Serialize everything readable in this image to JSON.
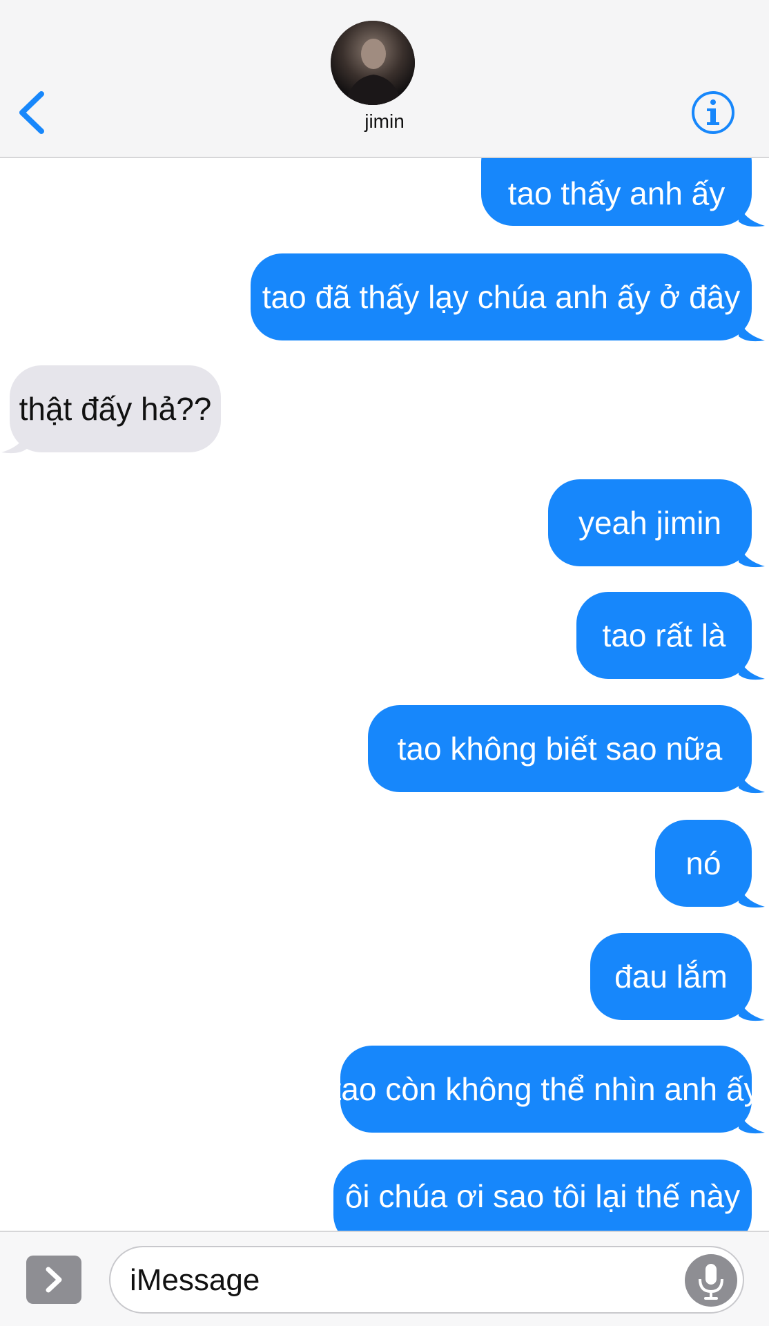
{
  "header": {
    "contact_name": "jimin",
    "back_icon": "chevron-left-icon",
    "info_icon": "info-icon"
  },
  "messages": [
    {
      "direction": "sent",
      "text": "tao thấy anh ấy"
    },
    {
      "direction": "sent",
      "text": "tao đã thấy lạy chúa anh ấy ở đây"
    },
    {
      "direction": "received",
      "text": "thật đấy hả??"
    },
    {
      "direction": "sent",
      "text": "yeah jimin"
    },
    {
      "direction": "sent",
      "text": "tao rất là"
    },
    {
      "direction": "sent",
      "text": "tao không biết sao nữa"
    },
    {
      "direction": "sent",
      "text": "nó"
    },
    {
      "direction": "sent",
      "text": "đau lắm"
    },
    {
      "direction": "sent",
      "text": "tao còn không thể nhìn anh ấy"
    },
    {
      "direction": "sent",
      "text": "ôi chúa ơi sao tôi lại thế này"
    }
  ],
  "composer": {
    "placeholder": "iMessage",
    "apps_icon": "chevron-right-icon",
    "mic_icon": "microphone-icon"
  },
  "colors": {
    "sent_bubble": "#1787fb",
    "received_bubble": "#e6e5eb",
    "accent": "#1787fb"
  }
}
